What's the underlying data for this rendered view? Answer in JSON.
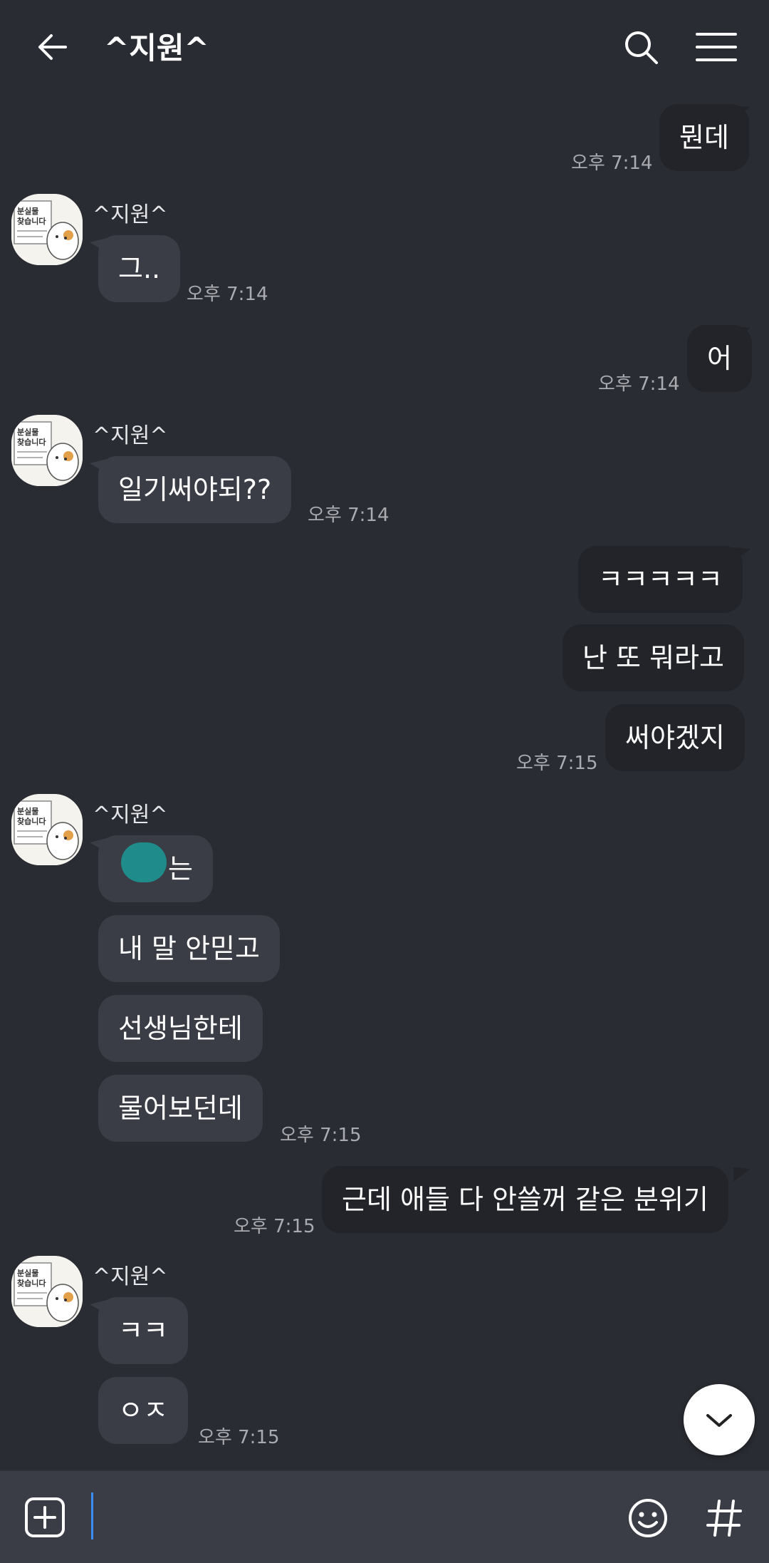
{
  "header": {
    "title": "^지원^"
  },
  "contact": {
    "name": "^지원^",
    "avatar_sign_text": "분실물 찾습니다"
  },
  "messages": [
    {
      "from": "me",
      "text": "뭔데",
      "time": "오후 7:14"
    },
    {
      "from": "other",
      "text": "그..",
      "time": "오후 7:14"
    },
    {
      "from": "me",
      "text": "어",
      "time": "오후 7:14"
    },
    {
      "from": "other",
      "text": "일기써야되??",
      "time": "오후 7:14"
    },
    {
      "from": "me",
      "text": "ㅋㅋㅋㅋㅋ"
    },
    {
      "from": "me",
      "text": "난 또 뭐라고"
    },
    {
      "from": "me",
      "text": "써야겠지",
      "time": "오후 7:15"
    },
    {
      "from": "other",
      "text": "는"
    },
    {
      "from": "other",
      "text": "내 말 안믿고"
    },
    {
      "from": "other",
      "text": "선생님한테"
    },
    {
      "from": "other",
      "text": "물어보던데",
      "time": "오후 7:15"
    },
    {
      "from": "me",
      "text": "근데 애들 다 안쓸꺼 같은 분위기",
      "time": "오후 7:15"
    },
    {
      "from": "other",
      "text": "ㅋㅋ"
    },
    {
      "from": "other",
      "text": "ㅇㅈ",
      "time": "오후 7:15"
    }
  ],
  "colors": {
    "background": "#2a2c33",
    "my_bubble": "#22242a",
    "their_bubble": "#3a3d45",
    "time_text": "#a9abb1",
    "cursor": "#3b8cf5"
  },
  "icons": [
    "back-arrow-icon",
    "search-icon",
    "menu-icon",
    "chevron-down-icon",
    "plus-box-icon",
    "emoji-icon",
    "hash-icon"
  ]
}
